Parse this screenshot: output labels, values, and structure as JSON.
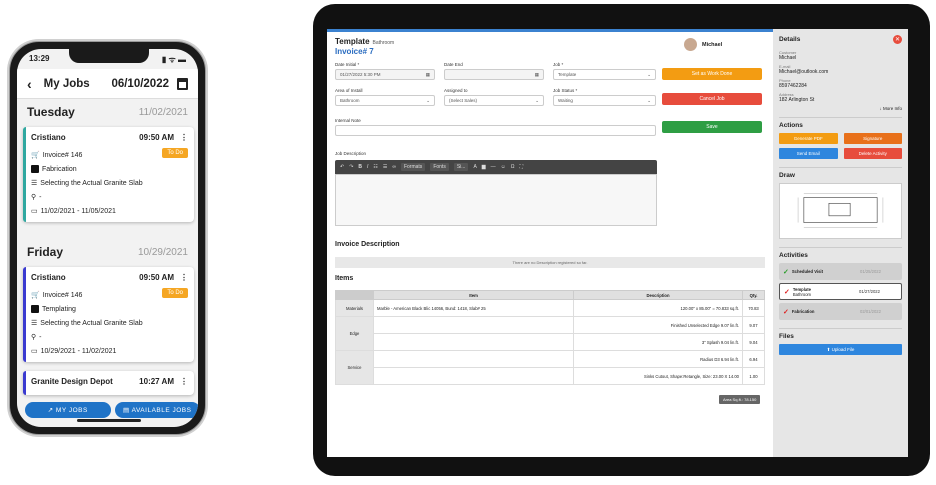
{
  "phone": {
    "status": {
      "time": "13:29",
      "icons": "▮ ᯤ ▬"
    },
    "header": {
      "back": "‹",
      "title": "My Jobs",
      "date": "06/10/2022"
    },
    "days": [
      {
        "name": "Tuesday",
        "date": "11/02/2021"
      },
      {
        "name": "Friday",
        "date": "10/29/2021"
      }
    ],
    "cards": [
      {
        "customer": "Cristiano",
        "time": "09:50 AM",
        "badge": "To Do",
        "invoice": "Invoice# 146",
        "job": "Fabrication",
        "stage": "Selecting the Actual Granite Slab",
        "location": "-",
        "dates": "11/02/2021 - 11/05/2021",
        "color": "#2fa8a0"
      },
      {
        "customer": "Cristiano",
        "time": "09:50 AM",
        "badge": "To Do",
        "invoice": "Invoice# 146",
        "job": "Templating",
        "stage": "Selecting the Actual Granite Slab",
        "location": "-",
        "dates": "10/29/2021 - 11/02/2021",
        "color": "#3a3ad0"
      },
      {
        "customer": "Granite Design Depot",
        "time": "10:27 AM",
        "color": "#3a3ad0"
      }
    ],
    "bottom": {
      "my_jobs": "↗  MY JOBS",
      "available_jobs": "▤  AVAILABLE JOBS"
    }
  },
  "tablet": {
    "header": {
      "template": "Template",
      "subtitle": "Bathroom",
      "invoice": "Invoice# 7",
      "user": "Michael"
    },
    "form": {
      "date_initial_label": "Date Initial *",
      "date_initial": "01/27/2022 5:30 PM",
      "date_end_label": "Date End",
      "date_end": "",
      "job_label": "Job *",
      "job": "Template",
      "area_label": "Area of Install",
      "area": "Bathroom",
      "assigned_label": "Assigned to",
      "assigned": "(Select Sales)",
      "status_label": "Job Status *",
      "status": "Waiting",
      "note_label": "Internal Note",
      "desc_label": "Job Description",
      "set_done": "Set as Work Done",
      "cancel": "Cancel Job",
      "save": "Save"
    },
    "editor_toolbar": {
      "format": "Formats",
      "font": "Fonts",
      "size": "Si..."
    },
    "invoice_desc": {
      "title": "Invoice Description",
      "empty": "There are no Description registered so far."
    },
    "items": {
      "title": "Items",
      "headers": [
        "Item",
        "Description",
        "Qty."
      ],
      "rows": [
        {
          "cat": "Materials",
          "item": "Marble - American Black Blic 14056, Bund: 1418, Slab# 25",
          "desc": "120.00\" x 85.00\" = 70.833 sq.ft.",
          "qty": "70.83"
        },
        {
          "cat": "Edge",
          "item": "",
          "desc": "Finished Unselected Edge 9.07 lin.ft.",
          "qty": "9.07"
        },
        {
          "cat": "",
          "item": "",
          "desc": "3\" Splash 9.04 lin.ft.",
          "qty": "9.04"
        },
        {
          "cat": "Service",
          "item": "",
          "desc": "Radius D3 6.94 lin.ft.",
          "qty": "6.94"
        },
        {
          "cat": "",
          "item": "",
          "desc": "Sinks Cutout, Shape:Retangle, Size: 23.00 X 14.00",
          "qty": "1.00"
        }
      ],
      "area": "Area Sq.ft.: 78.150"
    },
    "side": {
      "details_title": "Details",
      "customer_label": "Customer",
      "customer": "Michael",
      "email_label": "E-mail",
      "email": "Michael@outlook.com",
      "phone_label": "Phone",
      "phone": "8597462284",
      "address_label": "Address",
      "address": "182 Arlington St",
      "more_info": "More Info",
      "actions_title": "Actions",
      "generate_pdf": "Generate PDF",
      "signature": "Signature",
      "send_email": "Send Email",
      "delete_activity": "Delete Activity",
      "draw_title": "Draw",
      "activities_title": "Activities",
      "activities": [
        {
          "name": "Scheduled Visit",
          "sub": "",
          "date": "01/25/2022",
          "done": true
        },
        {
          "name": "Template",
          "sub": "Bathroom",
          "date": "01/27/2022",
          "done": false
        },
        {
          "name": "Fabrication",
          "sub": "",
          "date": "02/01/2022",
          "done": false
        }
      ],
      "files_title": "Files",
      "upload": "Upload File"
    }
  }
}
